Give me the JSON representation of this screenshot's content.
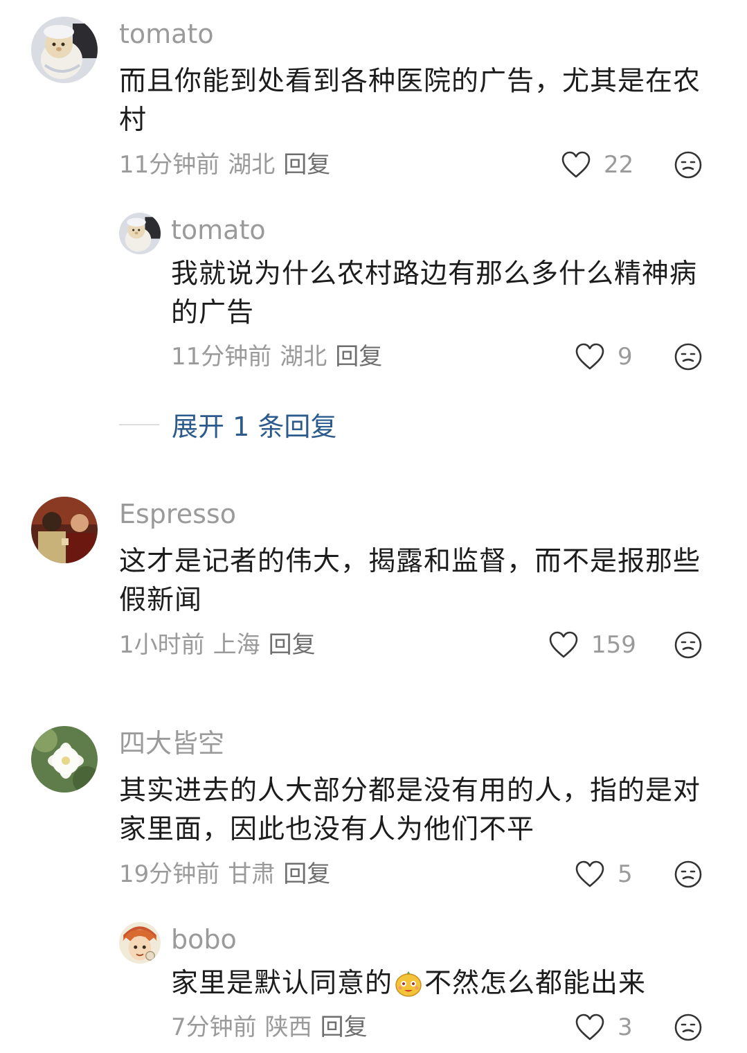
{
  "comments": [
    {
      "user": "tomato",
      "text": "而且你能到处看到各种医院的广告，尤其是在农村",
      "time": "11分钟前",
      "region": "湖北",
      "reply_label": "回复",
      "likes": "22",
      "avatar_icon": "plush-bear-avatar-icon",
      "replies": [
        {
          "user": "tomato",
          "text": "我就说为什么农村路边有那么多什么精神病的广告",
          "time": "11分钟前",
          "region": "湖北",
          "reply_label": "回复",
          "likes": "9",
          "avatar_icon": "plush-bear-avatar-icon"
        }
      ],
      "expand_label": "展开 1 条回复"
    },
    {
      "user": "Espresso",
      "text": "这才是记者的伟大，揭露和监督，而不是报那些假新闻",
      "time": "1小时前",
      "region": "上海",
      "reply_label": "回复",
      "likes": "159",
      "avatar_icon": "movie-scene-avatar-icon"
    },
    {
      "user": "四大皆空",
      "text": "其实进去的人大部分都是没有用的人，指的是对家里面，因此也没有人为他们不平",
      "time": "19分钟前",
      "region": "甘肃",
      "reply_label": "回复",
      "likes": "5",
      "avatar_icon": "lotus-flower-avatar-icon",
      "replies": [
        {
          "user": "bobo",
          "text_before_emoji": "家里是默认同意的",
          "emoji": "smiling-fruit-emoji",
          "text_after_emoji": "不然怎么都能出来",
          "time": "7分钟前",
          "region": "陕西",
          "reply_label": "回复",
          "likes": "3",
          "avatar_icon": "anime-character-avatar-icon"
        }
      ]
    }
  ],
  "icons": {
    "like": "heart-outline-icon",
    "dislike": "neutral-face-icon"
  },
  "colors": {
    "text": "#1c1c1c",
    "meta": "#9a9a9a",
    "link": "#2b5a8c"
  }
}
